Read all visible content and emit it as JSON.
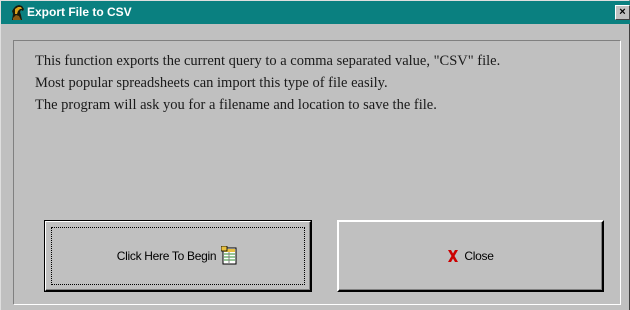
{
  "window": {
    "title": "Export File to CSV",
    "close_glyph": "×",
    "title_icon": "horse-logo-icon",
    "titlebar_color": "#0a8080",
    "face_color": "#c0c0c0"
  },
  "message": {
    "lines": [
      "This function exports the current query to a comma separated value, \"CSV\" file.",
      "Most popular spreadsheets can import this type of file easily.",
      "The program will ask you for a filename and location to save the file."
    ]
  },
  "buttons": {
    "begin": {
      "label": "Click Here To Begin",
      "icon": "spreadsheet-icon"
    },
    "close": {
      "label": "Close",
      "icon": "red-x-icon",
      "icon_color": "#cc0000"
    }
  }
}
